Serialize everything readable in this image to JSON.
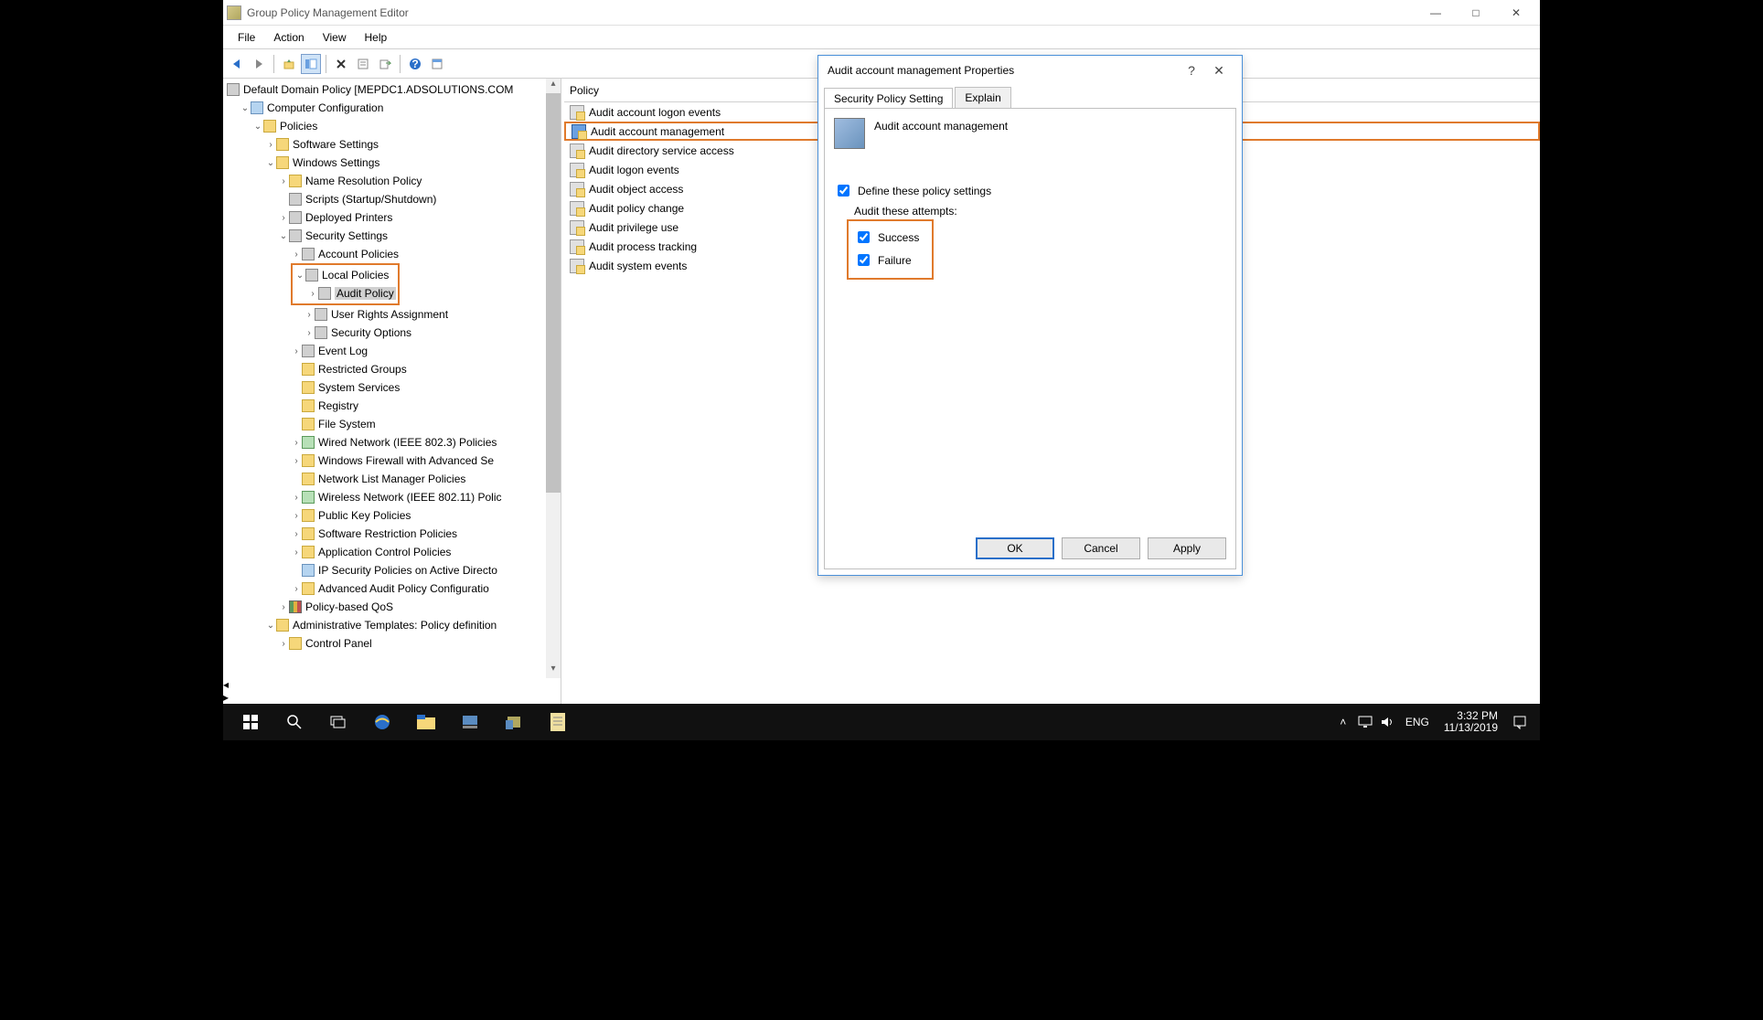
{
  "window": {
    "title": "Group Policy Management Editor"
  },
  "menubar": [
    "File",
    "Action",
    "View",
    "Help"
  ],
  "tree": {
    "root": "Default Domain Policy [MEPDC1.ADSOLUTIONS.COM",
    "computerConfig": "Computer Configuration",
    "policies": "Policies",
    "softwareSettings": "Software Settings",
    "windowsSettings": "Windows Settings",
    "nameResolution": "Name Resolution Policy",
    "scripts": "Scripts (Startup/Shutdown)",
    "deployedPrinters": "Deployed Printers",
    "securitySettings": "Security Settings",
    "accountPolicies": "Account Policies",
    "localPolicies": "Local Policies",
    "auditPolicy": "Audit Policy",
    "userRights": "User Rights Assignment",
    "securityOptions": "Security Options",
    "eventLog": "Event Log",
    "restrictedGroups": "Restricted Groups",
    "systemServices": "System Services",
    "registry": "Registry",
    "fileSystem": "File System",
    "wiredNetwork": "Wired Network (IEEE 802.3) Policies",
    "windowsFirewall": "Windows Firewall with Advanced Se",
    "networkListManager": "Network List Manager Policies",
    "wirelessNetwork": "Wireless Network (IEEE 802.11) Polic",
    "publicKey": "Public Key Policies",
    "softwareRestriction": "Software Restriction Policies",
    "applicationControl": "Application Control Policies",
    "ipsec": "IP Security Policies on Active Directo",
    "advancedAudit": "Advanced Audit Policy Configuratio",
    "policyQoS": "Policy-based QoS",
    "adminTemplates": "Administrative Templates: Policy definition",
    "controlPanel": "Control Panel"
  },
  "policy": {
    "header": "Policy",
    "items": [
      "Audit account logon events",
      "Audit account management",
      "Audit directory service access",
      "Audit logon events",
      "Audit object access",
      "Audit policy change",
      "Audit privilege use",
      "Audit process tracking",
      "Audit system events"
    ],
    "selectedIndex": 1
  },
  "dialog": {
    "title": "Audit account management Properties",
    "tabs": [
      "Security Policy Setting",
      "Explain"
    ],
    "heading": "Audit account management",
    "defineLabel": "Define these policy settings",
    "defineChecked": true,
    "attemptsLabel": "Audit these attempts:",
    "successLabel": "Success",
    "successChecked": true,
    "failureLabel": "Failure",
    "failureChecked": true,
    "buttons": {
      "ok": "OK",
      "cancel": "Cancel",
      "apply": "Apply"
    }
  },
  "taskbar": {
    "lang": "ENG",
    "time": "3:32 PM",
    "date": "11/13/2019"
  }
}
